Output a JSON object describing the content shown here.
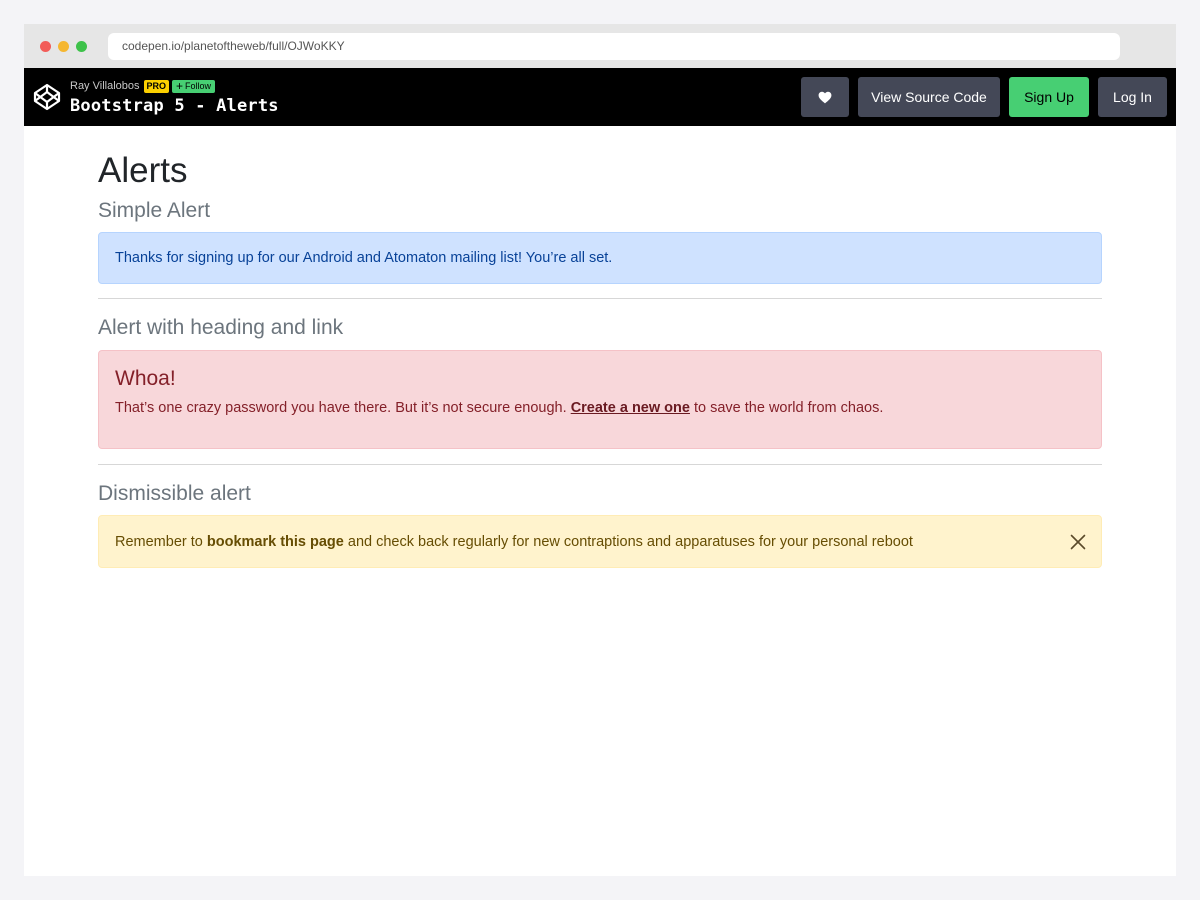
{
  "browser": {
    "url": "codepen.io/planetoftheweb/full/OJWoKKY"
  },
  "header": {
    "author": "Ray Villalobos",
    "pro_badge": "PRO",
    "follow_plus": "+",
    "follow_label": "Follow",
    "pen_title": "Bootstrap 5 - Alerts",
    "buttons": {
      "heart_icon": "heart-icon",
      "view_source": "View Source Code",
      "sign_up": "Sign Up",
      "log_in": "Log In"
    },
    "colors": {
      "bar": "#000000",
      "button": "#444857",
      "accent_green": "#47cf73",
      "pro_yellow": "#fcd000"
    }
  },
  "page": {
    "title": "Alerts",
    "sections": [
      {
        "heading": "Simple Alert",
        "alert": {
          "type": "info",
          "text": "Thanks for signing up for our Android and Atomaton mailing list! You’re all set."
        }
      },
      {
        "heading": "Alert with heading and link",
        "alert": {
          "type": "danger",
          "heading": "Whoa!",
          "text_before": "That’s one crazy password you have there. But it’s not secure enough. ",
          "link_text": "Create a new one",
          "text_after": " to save the world from chaos."
        }
      },
      {
        "heading": "Dismissible alert",
        "alert": {
          "type": "warning",
          "text_before": "Remember to ",
          "bold_text": "bookmark this page",
          "text_after": " and check back regularly for new contraptions and apparatuses for your personal reboot",
          "close_icon": "close-icon"
        }
      }
    ]
  }
}
